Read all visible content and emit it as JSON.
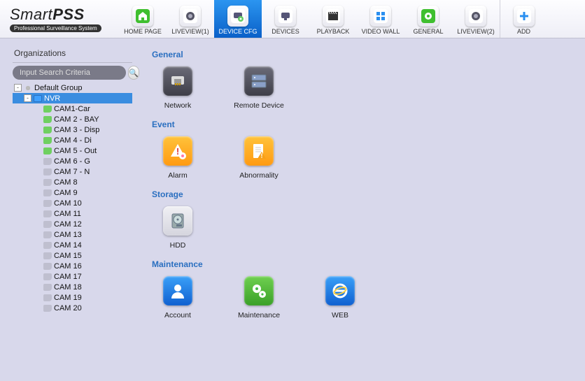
{
  "app": {
    "titlePlain": "Smart",
    "titleBold": "PSS",
    "subtitle": "Professional Surveillance System"
  },
  "nav": {
    "items": [
      {
        "id": "home",
        "label": "HOME PAGE",
        "icon": "home",
        "color": "green"
      },
      {
        "id": "lv1",
        "label": "LIVEVIEW(1)",
        "icon": "camera",
        "color": "plain"
      },
      {
        "id": "cfg",
        "label": "DEVICE CFG",
        "icon": "device-gear",
        "color": "blue",
        "active": true
      },
      {
        "id": "devices",
        "label": "DEVICES",
        "icon": "device",
        "color": "plain"
      },
      {
        "id": "playback",
        "label": "PLAYBACK",
        "icon": "clapper",
        "color": "plain"
      },
      {
        "id": "wall",
        "label": "VIDEO WALL",
        "icon": "grid",
        "color": "blue2"
      },
      {
        "id": "general",
        "label": "GENERAL",
        "icon": "gear",
        "color": "green"
      },
      {
        "id": "lv2",
        "label": "LIVEVIEW(2)",
        "icon": "camera",
        "color": "plain"
      },
      {
        "id": "add",
        "label": "ADD",
        "icon": "plus",
        "color": "plain",
        "sep": true
      }
    ]
  },
  "sidebar": {
    "title": "Organizations",
    "searchPlaceholder": "Input Search Criteria",
    "root": {
      "label": "Default Group",
      "expanded": true
    },
    "device": {
      "label": "NVR",
      "expanded": true,
      "selected": true
    },
    "cams": [
      {
        "label": "CAM1-Car",
        "online": true
      },
      {
        "label": "CAM 2 - BAY",
        "online": true
      },
      {
        "label": "CAM 3 - Disp",
        "online": true
      },
      {
        "label": "CAM 4 - Di",
        "online": true
      },
      {
        "label": "CAM 5 - Out",
        "online": true
      },
      {
        "label": "CAM 6 - G",
        "online": false
      },
      {
        "label": "CAM 7 - N",
        "online": false
      },
      {
        "label": "CAM 8",
        "online": false
      },
      {
        "label": "CAM 9",
        "online": false
      },
      {
        "label": "CAM 10",
        "online": false
      },
      {
        "label": "CAM 11",
        "online": false
      },
      {
        "label": "CAM 12",
        "online": false
      },
      {
        "label": "CAM 13",
        "online": false
      },
      {
        "label": "CAM 14",
        "online": false
      },
      {
        "label": "CAM 15",
        "online": false
      },
      {
        "label": "CAM 16",
        "online": false
      },
      {
        "label": "CAM 17",
        "online": false
      },
      {
        "label": "CAM 18",
        "online": false
      },
      {
        "label": "CAM 19",
        "online": false
      },
      {
        "label": "CAM 20",
        "online": false
      }
    ]
  },
  "sections": [
    {
      "title": "General",
      "items": [
        {
          "id": "network",
          "label": "Network",
          "bg": "bg-dark",
          "icon": "rj45"
        },
        {
          "id": "remote",
          "label": "Remote Device",
          "bg": "bg-dark",
          "icon": "rack"
        }
      ]
    },
    {
      "title": "Event",
      "items": [
        {
          "id": "alarm",
          "label": "Alarm",
          "bg": "bg-orange",
          "icon": "warn-gear"
        },
        {
          "id": "abn",
          "label": "Abnormality",
          "bg": "bg-orange",
          "icon": "doc-warn"
        }
      ]
    },
    {
      "title": "Storage",
      "items": [
        {
          "id": "hdd",
          "label": "HDD",
          "bg": "bg-gray",
          "icon": "hdd"
        }
      ]
    },
    {
      "title": "Maintenance",
      "items": [
        {
          "id": "account",
          "label": "Account",
          "bg": "bg-blue",
          "icon": "user"
        },
        {
          "id": "maint",
          "label": "Maintenance",
          "bg": "bg-green",
          "icon": "gears"
        },
        {
          "id": "web",
          "label": "WEB",
          "bg": "bg-blue",
          "icon": "ie"
        }
      ]
    }
  ]
}
